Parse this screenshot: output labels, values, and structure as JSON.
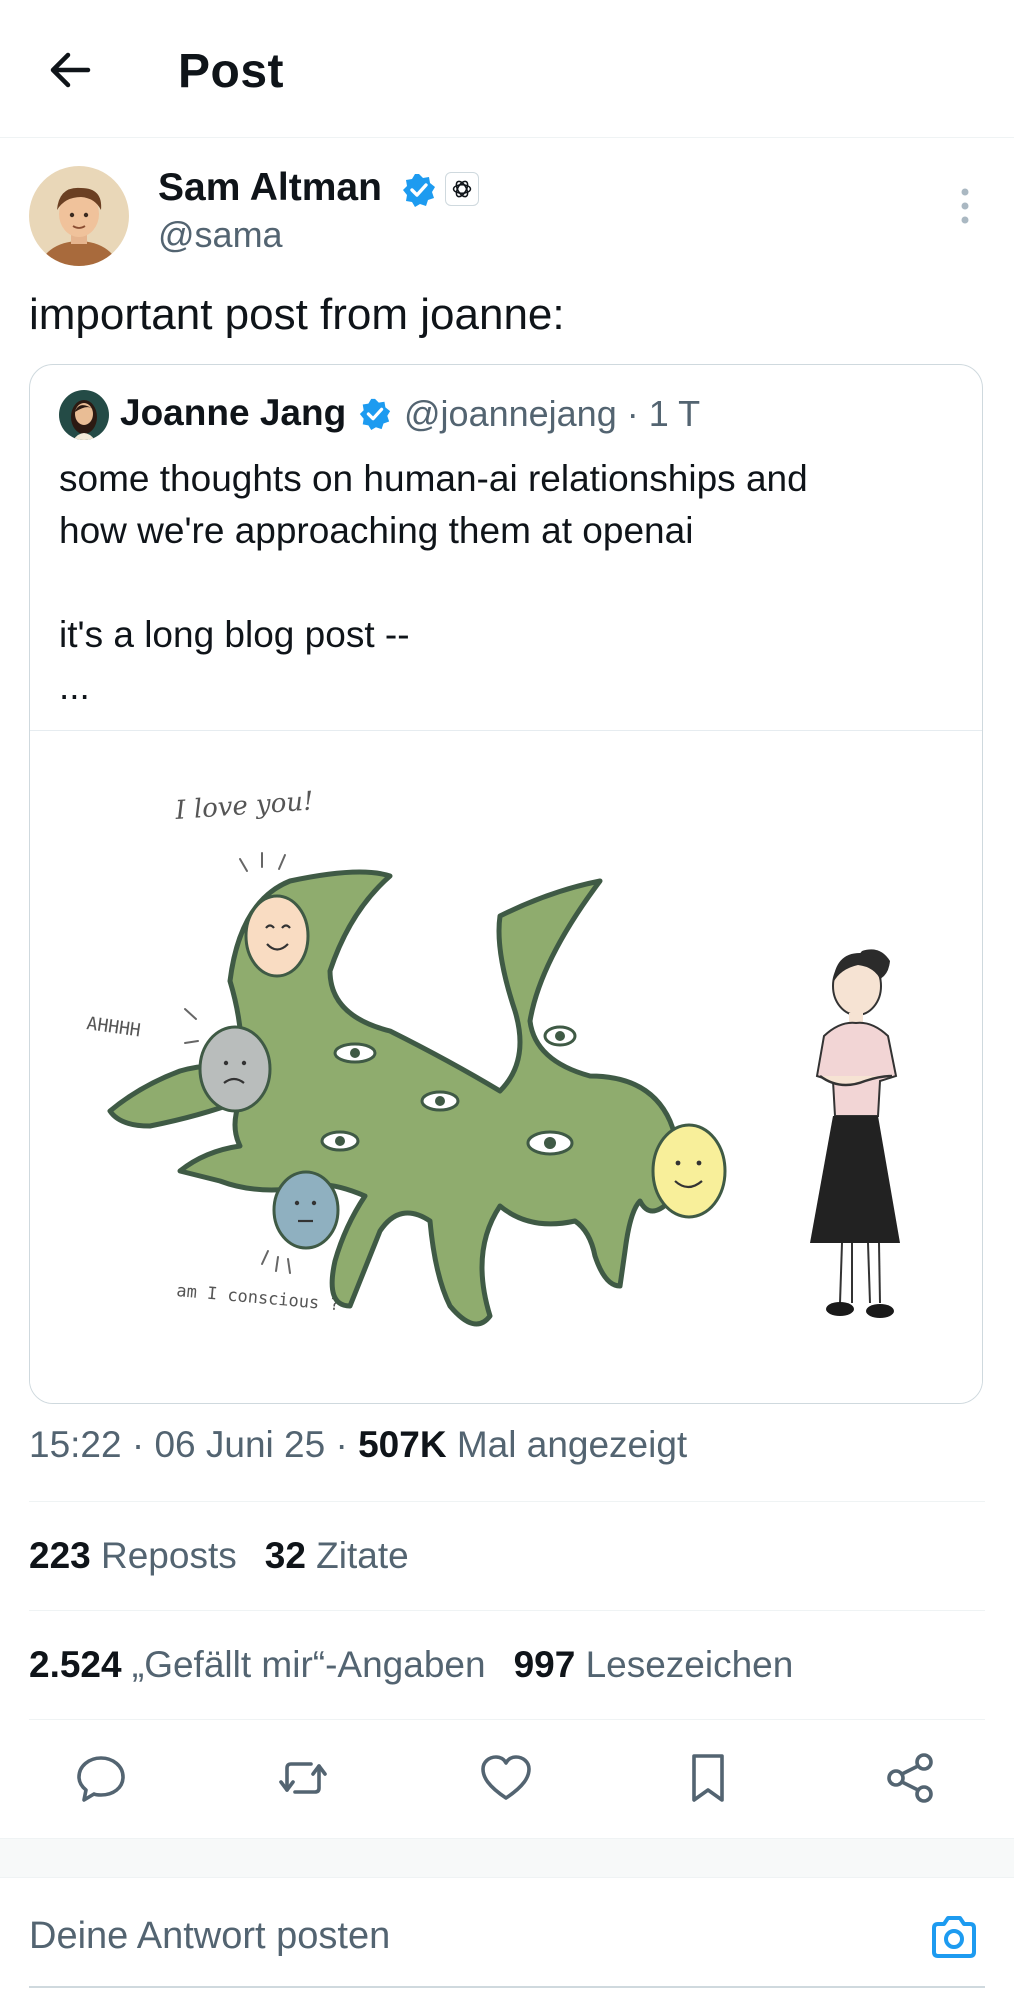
{
  "header": {
    "title": "Post"
  },
  "post": {
    "author_name": "Sam Altman",
    "author_handle": "@sama",
    "text": "important post from joanne:"
  },
  "quote": {
    "author_name": "Joanne Jang",
    "author_handle": "@joannejang · 1 T",
    "body": "some thoughts on human-ai relationships and\nhow we're approaching them at openai\n\nit's a long blog post --\n...",
    "image_texts": {
      "love": "I love you!",
      "scream": "AHHHH",
      "conscious": "am I conscious ?"
    }
  },
  "meta": {
    "time_date": "15:22 · 06 Juni 25 · ",
    "views_count": "507K",
    "views_label": " Mal angezeigt"
  },
  "stats": {
    "reposts_count": "223",
    "reposts_label": " Reposts",
    "quotes_count": "32",
    "quotes_label": " Zitate",
    "likes_count": "2.524",
    "likes_label": " „Gefällt mir“-Angaben",
    "bookmarks_count": "997",
    "bookmarks_label": " Lesezeichen"
  },
  "reply": {
    "placeholder": "Deine Antwort posten"
  },
  "colors": {
    "accent": "#1d9bf0",
    "muted": "#536471",
    "creature": "#8fac6e",
    "outline": "#3f5a45"
  }
}
